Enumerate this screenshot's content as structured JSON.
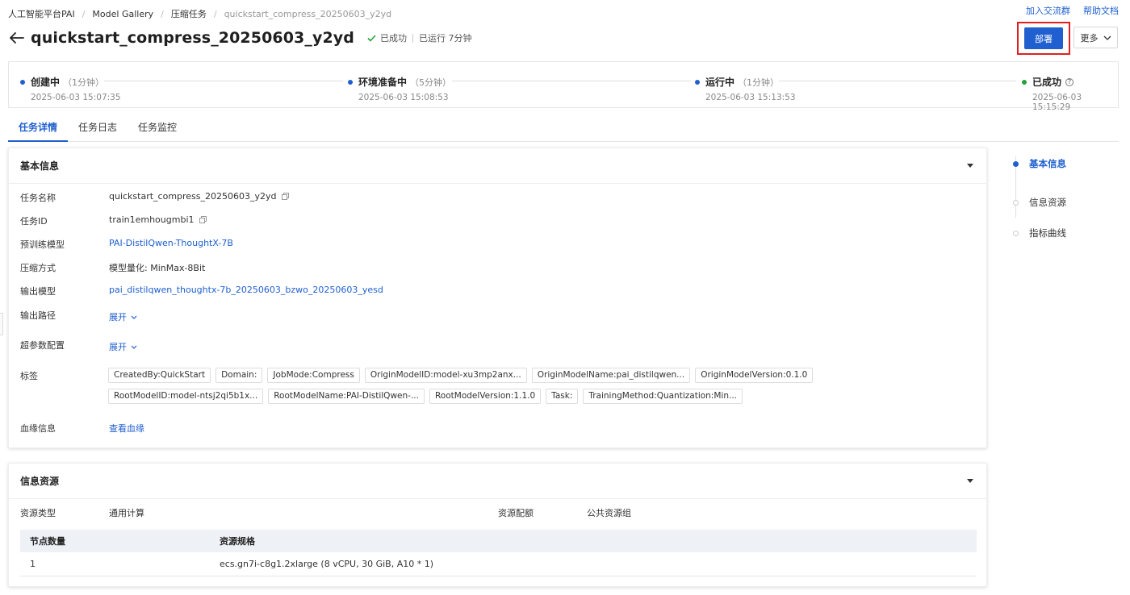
{
  "breadcrumb": [
    "人工智能平台PAI",
    "Model Gallery",
    "压缩任务",
    "quickstart_compress_20250603_y2yd"
  ],
  "top_links": {
    "join": "加入交流群",
    "help": "帮助文档"
  },
  "header": {
    "title": "quickstart_compress_20250603_y2yd",
    "status": "已成功",
    "runtime": "已运行 7分钟",
    "deploy_label": "部署",
    "more_label": "更多"
  },
  "timeline": [
    {
      "name": "创建中",
      "duration": "（1分钟）",
      "time": "2025-06-03 15:07:35"
    },
    {
      "name": "环境准备中",
      "duration": "（5分钟）",
      "time": "2025-06-03 15:08:53"
    },
    {
      "name": "运行中",
      "duration": "（1分钟）",
      "time": "2025-06-03 15:13:53"
    },
    {
      "name": "已成功",
      "duration": "",
      "time": "2025-06-03 15:15:29"
    }
  ],
  "tabs": [
    "任务详情",
    "任务日志",
    "任务监控"
  ],
  "basic": {
    "title": "基本信息",
    "fields": [
      {
        "k": "任务名称",
        "v": "quickstart_compress_20250603_y2yd"
      },
      {
        "k": "任务ID",
        "v": "train1emhougmbi1"
      },
      {
        "k": "预训练模型",
        "v": "PAI-DistilQwen-ThoughtX-7B"
      },
      {
        "k": "压缩方式",
        "v": "模型量化: MinMax-8Bit"
      },
      {
        "k": "输出模型",
        "v": "pai_distilqwen_thoughtx-7b_20250603_bzwo_20250603_yesd"
      },
      {
        "k": "输出路径",
        "v": "展开"
      },
      {
        "k": "超参数配置",
        "v": "展开"
      },
      {
        "k": "标签",
        "v": ""
      },
      {
        "k": "血缘信息",
        "v": "查看血缘"
      }
    ],
    "tags": [
      "CreatedBy:QuickStart",
      "Domain:",
      "JobMode:Compress",
      "OriginModelID:model-xu3mp2anx...",
      "OriginModelName:pai_distilqwen...",
      "OriginModelVersion:0.1.0",
      "RootModelID:model-ntsj2qi5b1x...",
      "RootModelName:PAI-DistilQwen-...",
      "RootModelVersion:1.1.0",
      "Task:",
      "TrainingMethod:Quantization:Min..."
    ]
  },
  "resource": {
    "title": "信息资源",
    "type_label": "资源类型",
    "type_value": "通用计算",
    "quota_label": "资源配额",
    "quota_value": "公共资源组",
    "columns": [
      "节点数量",
      "资源规格"
    ],
    "rows": [
      [
        "1",
        "ecs.gn7i-c8g1.2xlarge (8 vCPU, 30 GiB, A10 * 1)"
      ]
    ]
  },
  "anchor": [
    "基本信息",
    "信息资源",
    "指标曲线"
  ]
}
